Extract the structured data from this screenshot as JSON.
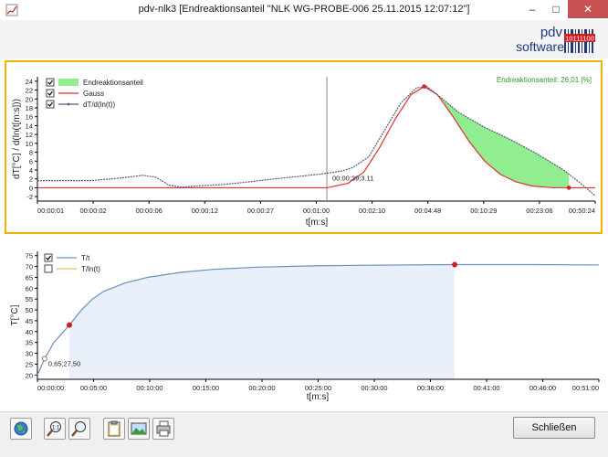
{
  "window": {
    "title": "pdv-nlk3 [Endreaktionsanteil \"NLK WG-PROBE-006 25.11.2015 12:07:12\"]"
  },
  "logo": {
    "line1": "pdv",
    "line2": "software",
    "code": "10111100"
  },
  "chart_data": [
    {
      "type": "line",
      "ylabel": "dT[°C] / d(ln(t[m:s]))",
      "xlabel": "t[m:s]",
      "y_ticks": [
        "24",
        "22",
        "20",
        "18",
        "16",
        "14",
        "12",
        "10",
        "8",
        "6",
        "4",
        "2",
        "0",
        "-2"
      ],
      "x_ticks": [
        "00:00:01",
        "00:00:02",
        "00:00:06",
        "00:00:12",
        "00:00:27",
        "00:01:00",
        "00:02:10",
        "00:04:48",
        "00:10:29",
        "00:23:06",
        "00:50:24"
      ],
      "ylim": [
        -3,
        25
      ],
      "legend": [
        {
          "name": "Endreaktionsanteil",
          "checked": true,
          "color": "#90ee90"
        },
        {
          "name": "Gauss",
          "checked": true,
          "color": "#e03030"
        },
        {
          "name": "dT/d(ln(t))",
          "checked": true,
          "color": "#5a5a7a"
        }
      ],
      "info": "Endreaktionsanteil: 26,01 [%]",
      "cursor_label": "00:00:39;3.11",
      "series": {
        "measured": [
          [
            0,
            1.6
          ],
          [
            0.5,
            1.6
          ],
          [
            1,
            1.6
          ],
          [
            1.5,
            2.1
          ],
          [
            2,
            2.8
          ],
          [
            2.25,
            2.4
          ],
          [
            2.5,
            0.6
          ],
          [
            2.75,
            0.1
          ],
          [
            3,
            0.4
          ],
          [
            3.5,
            0.7
          ],
          [
            4,
            1.3
          ],
          [
            4.5,
            2.0
          ],
          [
            5,
            2.6
          ],
          [
            5.4,
            3.1
          ],
          [
            5.8,
            3.8
          ],
          [
            6,
            4.6
          ],
          [
            6.3,
            7
          ],
          [
            6.6,
            13
          ],
          [
            6.9,
            19
          ],
          [
            7.2,
            22.5
          ],
          [
            7.4,
            22.8
          ],
          [
            7.7,
            20
          ],
          [
            8,
            17
          ],
          [
            8.5,
            13.6
          ],
          [
            9,
            10.8
          ],
          [
            9.5,
            7.6
          ],
          [
            10,
            4.0
          ],
          [
            10.3,
            1.2
          ],
          [
            10.6,
            -1.8
          ]
        ],
        "gauss": [
          [
            0,
            0
          ],
          [
            5.5,
            0
          ],
          [
            5.9,
            1.0
          ],
          [
            6.2,
            3.5
          ],
          [
            6.5,
            9
          ],
          [
            6.8,
            15.5
          ],
          [
            7.1,
            21
          ],
          [
            7.35,
            22.8
          ],
          [
            7.6,
            21
          ],
          [
            7.9,
            16
          ],
          [
            8.2,
            10.5
          ],
          [
            8.5,
            6
          ],
          [
            8.8,
            3
          ],
          [
            9.1,
            1.3
          ],
          [
            9.4,
            0.4
          ],
          [
            9.8,
            0
          ],
          [
            10.6,
            0
          ]
        ]
      },
      "markers": [
        [
          7.35,
          22.8
        ],
        [
          10.1,
          0
        ]
      ],
      "cursor_x": 5.5,
      "x_range": [
        0,
        10.6
      ]
    },
    {
      "type": "line",
      "ylabel": "T[°C]",
      "xlabel": "t[m:s]",
      "y_ticks": [
        "75",
        "70",
        "65",
        "60",
        "55",
        "50",
        "45",
        "40",
        "35",
        "30",
        "25",
        "20"
      ],
      "x_ticks": [
        "00:00:00",
        "00:05:00",
        "00:10:00",
        "00:15:00",
        "00:20:00",
        "00:25:00",
        "00:30:00",
        "00:36:00",
        "00:41:00",
        "00:46:00",
        "00:51:00"
      ],
      "ylim": [
        18,
        77
      ],
      "legend": [
        {
          "name": "T/t",
          "checked": true,
          "color": "#6a8fc0"
        },
        {
          "name": "T/ln(t)",
          "checked": false,
          "color": "#e8c060"
        }
      ],
      "start_label": "0,65;27,50",
      "x_range": [
        0,
        51
      ],
      "shade_range": [
        2.9,
        37.9
      ],
      "series": {
        "temperature": [
          [
            0,
            20
          ],
          [
            0.65,
            27.5
          ],
          [
            1.5,
            35
          ],
          [
            2.9,
            43
          ],
          [
            4,
            50
          ],
          [
            5,
            55
          ],
          [
            6,
            58.5
          ],
          [
            8,
            62.5
          ],
          [
            10,
            65
          ],
          [
            13,
            67.3
          ],
          [
            16,
            68.7
          ],
          [
            20,
            69.7
          ],
          [
            25,
            70.3
          ],
          [
            30,
            70.6
          ],
          [
            37.9,
            70.9
          ],
          [
            45,
            70.9
          ],
          [
            51,
            70.7
          ]
        ]
      },
      "markers": [
        [
          0.65,
          27.5,
          "open"
        ],
        [
          2.9,
          43,
          "filled"
        ],
        [
          37.9,
          70.9,
          "filled"
        ]
      ]
    }
  ],
  "footer": {
    "close_label": "Schließen"
  }
}
